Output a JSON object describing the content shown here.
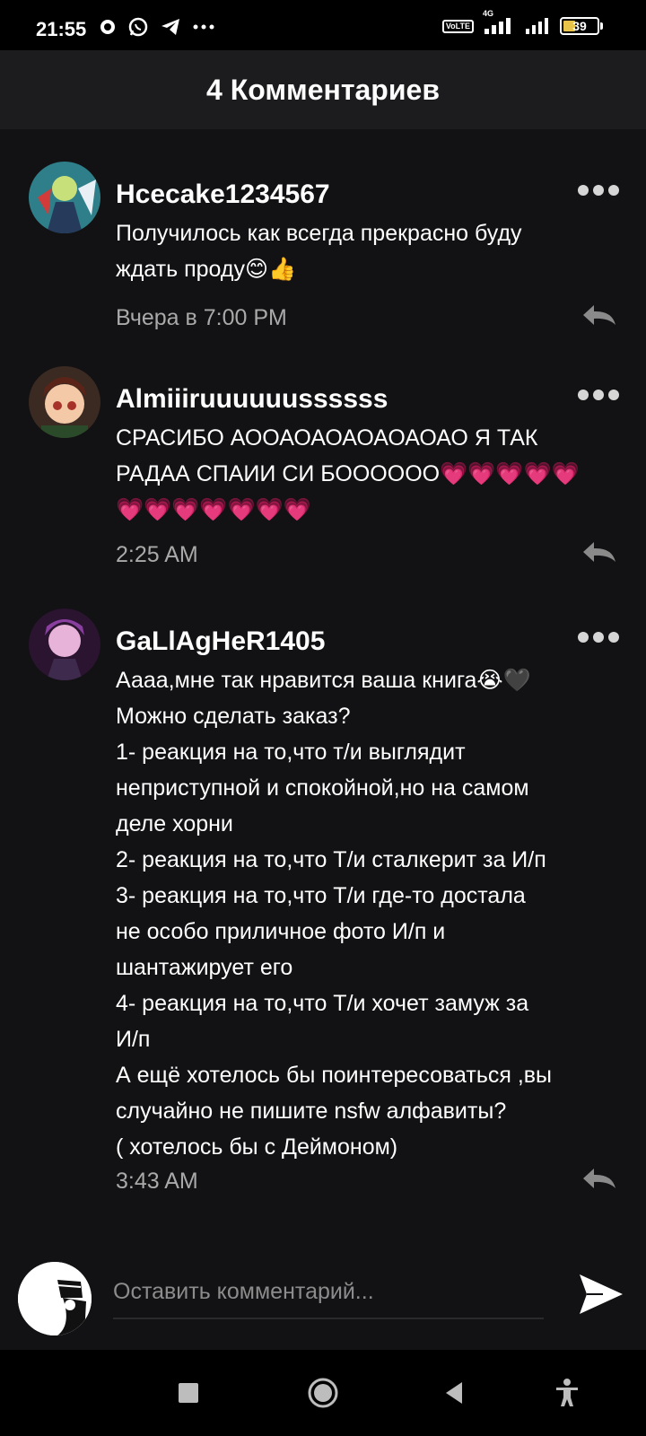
{
  "status_bar": {
    "time": "21:55",
    "battery": "39",
    "network": "4G",
    "volte_line1": "Vo",
    "volte_line2": "LTE"
  },
  "header": {
    "title": "4 Комментариев"
  },
  "comments": [
    {
      "username": "Hcecake1234567",
      "lines": [
        "Получилось как всегда прекрасно буду",
        "ждать проду😊👍"
      ],
      "timestamp": "Вчера в 7:00 PM"
    },
    {
      "username": "Almiiiruuuuuussssss",
      "lines": [
        "СРАСИБО АООАОАОАОАОАОАО Я ТАК",
        "РАДАА СПАИИ СИ БОООООО💗💗💗💗💗",
        "💗💗💗💗💗💗💗"
      ],
      "timestamp": "2:25 AM"
    },
    {
      "username": "GaLlAgHeR1405",
      "lines": [
        "Аааа,мне так нравится ваша книга😭🖤",
        "Можно сделать заказ?",
        "1- реакция на то,что т/и выглядит",
        "неприступной и спокойной,но на самом",
        "деле хорни",
        "2- реакция на то,что Т/и сталкерит за И/п",
        "3- реакция на то,что Т/и где-то достала",
        "не особо приличное   фото И/п  и",
        "шантажирует его",
        "4- реакция на то,что Т/и хочет замуж за",
        "И/п",
        "А ещё хотелось бы поинтересоваться ,вы",
        "случайно не пишите nsfw алфавиты?",
        "( хотелось бы с Деймоном)"
      ],
      "timestamp": "3:43 AM"
    }
  ],
  "comment_input": {
    "placeholder": "Оставить комментарий..."
  },
  "colors": {
    "background": "#121113",
    "header": "#1c1b1d",
    "timestamp": "#a9a9a9",
    "battery_fill": "#e8c34a"
  },
  "icons": [
    "more-dots-icon",
    "reply-icon",
    "send-icon",
    "stop-square-icon",
    "home-circle-icon",
    "back-triangle-icon",
    "accessibility-icon"
  ]
}
